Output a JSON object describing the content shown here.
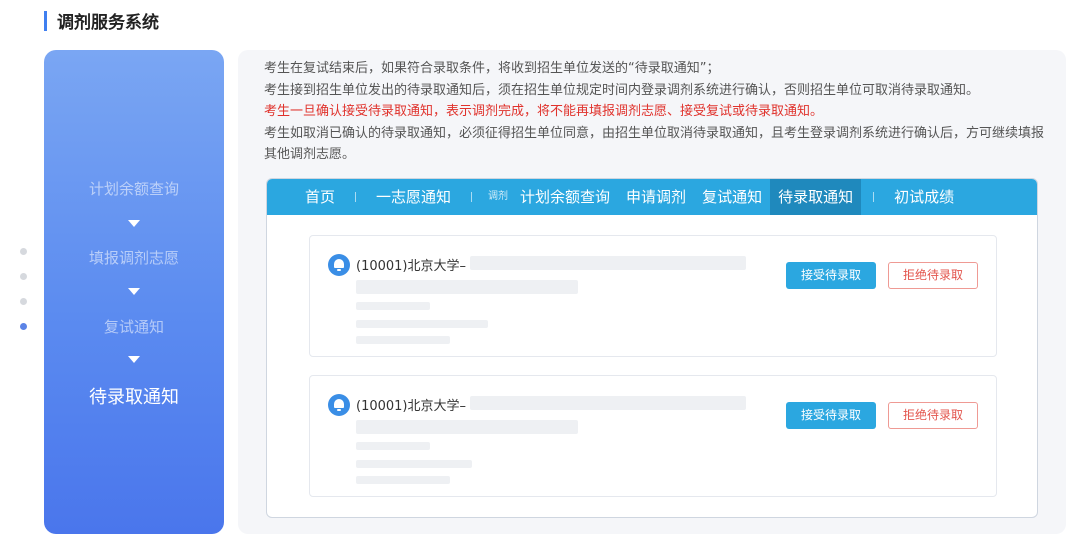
{
  "header": {
    "title": "调剂服务系统"
  },
  "steps": [
    {
      "label": "计划余额查询"
    },
    {
      "label": "填报调剂志愿"
    },
    {
      "label": "复试通知"
    },
    {
      "label": "待录取通知"
    }
  ],
  "notes": [
    {
      "text": "考生在复试结束后，如果符合录取条件，将收到招生单位发送的“待录取通知”；"
    },
    {
      "text": "考生接到招生单位发出的待录取通知后，须在招生单位规定时间内登录调剂系统进行确认，否则招生单位可取消待录取通知。"
    },
    {
      "text": "考生一旦确认接受待录取通知，表示调剂完成，将不能再填报调剂志愿、接受复试或待录取通知。"
    },
    {
      "text": "考生如取消已确认的待录取通知，必须征得招生单位同意，由招生单位取消待录取通知，且考生登录调剂系统进行确认后，方可继续填报其他调剂志愿。"
    }
  ],
  "nav": {
    "home": "首页",
    "first_choice": "一志愿通知",
    "adjust_small": "调剂",
    "plan_query": "计划余额查询",
    "apply_adjust": "申请调剂",
    "retest": "复试通知",
    "pending_admission": "待录取通知",
    "prelim_scores": "初试成绩"
  },
  "cards": [
    {
      "university": "(10001)北京大学–",
      "accept_label": "接受待录取",
      "reject_label": "拒绝待录取"
    },
    {
      "university": "(10001)北京大学–",
      "accept_label": "接受待录取",
      "reject_label": "拒绝待录取"
    }
  ],
  "colors": {
    "accent": "#2ba7e0",
    "panel_blue": "#5b8bf0",
    "warning_red": "#e0322c"
  }
}
